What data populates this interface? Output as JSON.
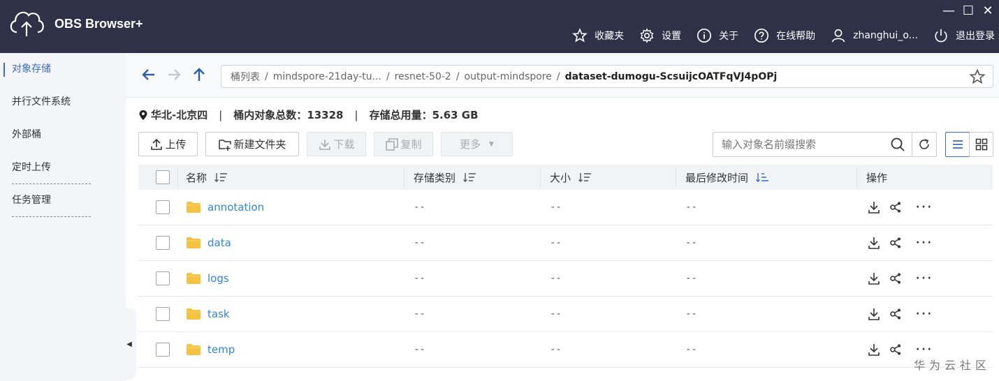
{
  "app": {
    "title": "OBS Browser+"
  },
  "window_controls": {
    "minimize": "—",
    "maximize": "☐",
    "close": "✕"
  },
  "topnav": [
    {
      "label": "收藏夹",
      "icon": "star-icon"
    },
    {
      "label": "设置",
      "icon": "gear-icon"
    },
    {
      "label": "关于",
      "icon": "info-icon"
    },
    {
      "label": "在线帮助",
      "icon": "help-icon"
    },
    {
      "label": "zhanghui_o...",
      "icon": "user-icon"
    },
    {
      "label": "退出登录",
      "icon": "power-icon"
    }
  ],
  "sidebar": {
    "items": [
      {
        "label": "对象存储",
        "active": true
      },
      {
        "label": "并行文件系统",
        "active": false
      },
      {
        "label": "外部桶",
        "active": false
      },
      {
        "label": "定时上传",
        "active": false
      },
      {
        "label": "任务管理",
        "active": false
      }
    ],
    "collapse": "◀"
  },
  "path": {
    "segments": [
      "桶列表",
      "mindspore-21day-tu...",
      "resnet-50-2",
      "output-mindspore"
    ],
    "separator": "/",
    "current": "dataset-dumogu-ScsuijcOATFqVJ4pOPj"
  },
  "info": {
    "region": "华北-北京四",
    "separator": "|",
    "object_count_label": "桶内对象总数：",
    "object_count": "13328",
    "storage_label": "存储总用量：",
    "storage_value": "5.63 GB"
  },
  "toolbar": {
    "upload": "上传",
    "new_folder": "新建文件夹",
    "download": "下载",
    "copy": "复制",
    "more": "更多"
  },
  "search": {
    "placeholder": "输入对象名前缀搜索",
    "value": ""
  },
  "table": {
    "columns": [
      "名称",
      "存储类别",
      "大小",
      "最后修改时间",
      "操作"
    ],
    "rows": [
      {
        "name": "annotation",
        "storage_class": "--",
        "size": "--",
        "modified": "--"
      },
      {
        "name": "data",
        "storage_class": "--",
        "size": "--",
        "modified": "--"
      },
      {
        "name": "logs",
        "storage_class": "--",
        "size": "--",
        "modified": "--"
      },
      {
        "name": "task",
        "storage_class": "--",
        "size": "--",
        "modified": "--"
      },
      {
        "name": "temp",
        "storage_class": "--",
        "size": "--",
        "modified": "--"
      }
    ],
    "more_label": "···"
  },
  "watermark": "华为云社区",
  "colors": {
    "header_bg": "#2f3149",
    "accent": "#3b6bc5",
    "link": "#2e86de",
    "folder": "#f5c242"
  }
}
